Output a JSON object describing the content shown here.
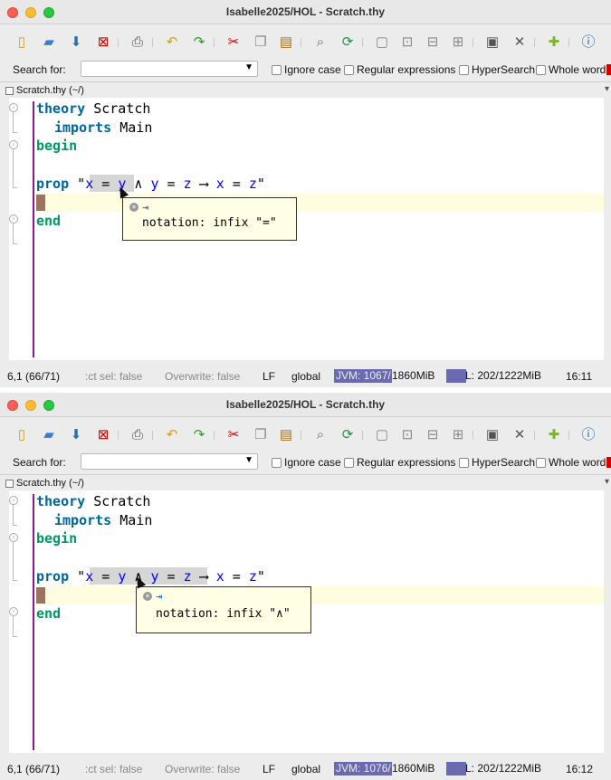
{
  "panels": [
    {
      "title": "Isabelle2025/HOL - Scratch.thy",
      "search": {
        "label": "Search for:",
        "value": "",
        "options": [
          "Ignore case",
          "Regular expressions",
          "HyperSearch",
          "Whole word"
        ]
      },
      "file_tab": "Scratch.thy (~/)",
      "code": {
        "l1_kw": "theory",
        "l1_rest": " Scratch",
        "l2_kw": "imports",
        "l2_rest": " Main",
        "l3_kw": "begin",
        "l5_kw": "prop",
        "l5_q1": " \"",
        "l5_x1": "x",
        "l5_eq1": " = ",
        "l5_y1": "y",
        "l5_and": " ∧ ",
        "l5_y2": "y",
        "l5_eq2": " = ",
        "l5_z1": "z",
        "l5_imp": " ⟶ ",
        "l5_x2": "x",
        "l5_eq3": " = ",
        "l5_z2": "z",
        "l5_q2": "\"",
        "l7_kw": "end"
      },
      "tooltip": {
        "text": "notation: infix \"=\""
      },
      "status": {
        "position": "6,1 (66/71)",
        "select": ":ct sel: false",
        "overwrite": "Overwrite: false",
        "line_ending": "LF",
        "mode": "global",
        "jvm": "JVM: 1067/",
        "jvm_total": "1860MiB",
        "ml": "L: 202/1222MiB",
        "time": "16:11"
      }
    },
    {
      "title": "Isabelle2025/HOL - Scratch.thy",
      "search": {
        "label": "Search for:",
        "value": "",
        "options": [
          "Ignore case",
          "Regular expressions",
          "HyperSearch",
          "Whole word"
        ]
      },
      "file_tab": "Scratch.thy (~/)",
      "code": {
        "l1_kw": "theory",
        "l1_rest": " Scratch",
        "l2_kw": "imports",
        "l2_rest": " Main",
        "l3_kw": "begin",
        "l5_kw": "prop",
        "l5_q1": " \"",
        "l5_x1": "x",
        "l5_eq1": " = ",
        "l5_y1": "y",
        "l5_and": " ∧ ",
        "l5_y2": "y",
        "l5_eq2": " = ",
        "l5_z1": "z",
        "l5_imp": " ⟶ ",
        "l5_x2": "x",
        "l5_eq3": " = ",
        "l5_z2": "z",
        "l5_q2": "\"",
        "l7_kw": "end"
      },
      "tooltip": {
        "text": "notation: infix \"∧\""
      },
      "status": {
        "position": "6,1 (66/71)",
        "select": ":ct sel: false",
        "overwrite": "Overwrite: false",
        "line_ending": "LF",
        "mode": "global",
        "jvm": "JVM: 1076/",
        "jvm_total": "1860MiB",
        "ml": "L: 202/1222MiB",
        "time": "16:12"
      }
    }
  ],
  "colors": {
    "keyword": "#006699",
    "keyword_begin_end": "#009966",
    "free_var": "#0000ff",
    "gutter_line": "#8b1a8b",
    "memory_bar": "#6a6ab0"
  },
  "icons": [
    "new-file-icon",
    "open-file-icon",
    "save-icon",
    "close-icon",
    "print-icon",
    "undo-icon",
    "redo-icon",
    "cut-icon",
    "copy-icon",
    "paste-icon",
    "find-icon",
    "find-replace-icon",
    "new-view-icon",
    "split-horizontal-icon",
    "split-vertical-icon",
    "unsplit-icon",
    "buffer-options-icon",
    "global-options-icon",
    "plugins-icon",
    "help-icon"
  ]
}
